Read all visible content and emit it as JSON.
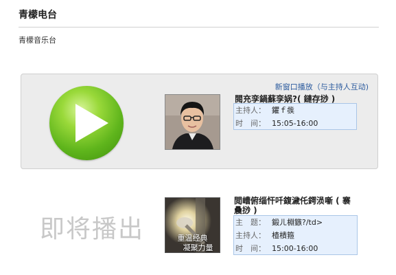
{
  "header": {
    "title": "青檬电台",
    "subtitle": "青檬音乐台"
  },
  "player": {
    "new_window_link": "新窗口播放（与主持人互动)",
    "current_show": {
      "title": "閱充孪鍋蘇孪娲?( 鏈存挱 )",
      "host_label": "主持人：",
      "host_value": "鑺ｆ彂",
      "time_label": "时　间：",
      "time_value": "15:05-16:00"
    }
  },
  "upcoming": {
    "label": "即将播出",
    "image_caption_line1": "重温经典",
    "image_caption_line2": "凝聚力量",
    "next_show": {
      "title": "閲嶆俯缁忓吀鍑濊仛鍔涢噺 ( 褰曟挱 )",
      "topic_label": "主　题：",
      "topic_value": "鍛ㄦ棩鏃?/td>",
      "host_label": "主持人：",
      "host_value": "楂樻箍",
      "time_label": "时　间：",
      "time_value": "15:00-16:00"
    }
  },
  "colors": {
    "accent_link": "#2c5b9e",
    "info_box_bg": "#e6f0fd",
    "info_box_border": "#a9c5e7",
    "play_green": "#5fb51c"
  }
}
